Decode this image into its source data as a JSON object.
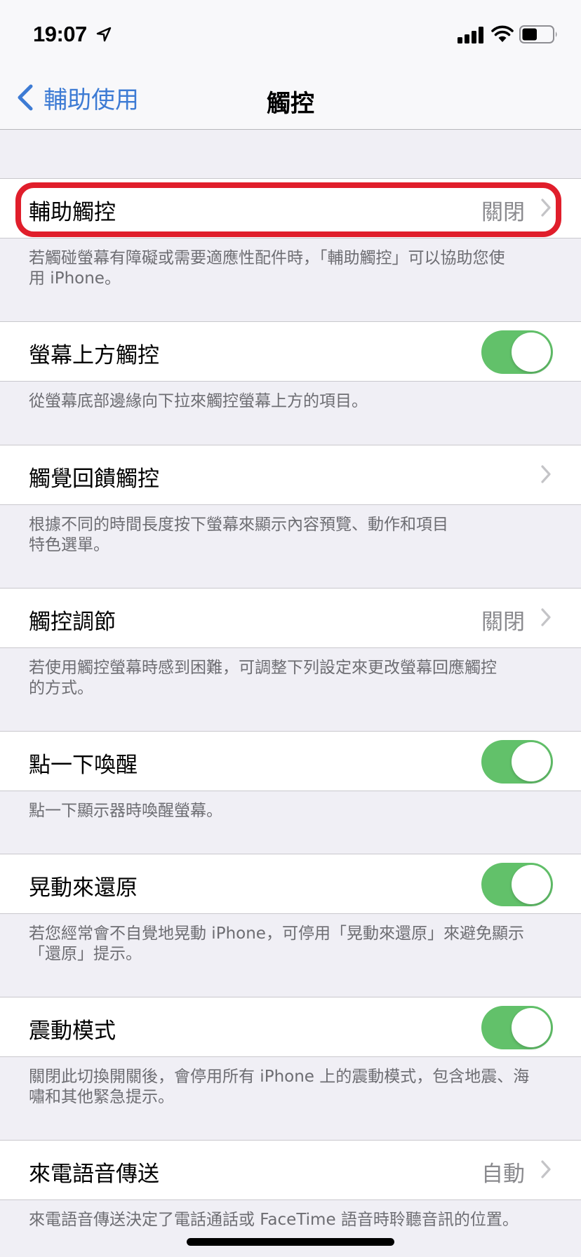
{
  "status_bar": {
    "time": "19:07",
    "location_icon": "location-arrow-icon",
    "signal_icon": "cellular-signal-icon",
    "wifi_icon": "wifi-icon",
    "battery_icon": "battery-icon",
    "battery_level": 0.5
  },
  "nav": {
    "back_label": "輔助使用",
    "back_icon": "chevron-left-icon",
    "title": "觸控"
  },
  "colors": {
    "accent": "#3d7bd4",
    "toggle_on": "#62c16a",
    "highlight": "#e01e2b",
    "background": "#f0eff5"
  },
  "settings": [
    {
      "label": "輔助觸控",
      "type": "disclosure",
      "value": "關閉",
      "highlighted": true,
      "footer_lines": [
        "若觸碰螢幕有障礙或需要適應性配件時，「輔助觸控」可以協助您使",
        "用 iPhone。"
      ]
    },
    {
      "label": "螢幕上方觸控",
      "type": "toggle",
      "on": true,
      "footer_lines": [
        "從螢幕底部邊緣向下拉來觸控螢幕上方的項目。"
      ]
    },
    {
      "label": "觸覺回饋觸控",
      "type": "disclosure",
      "value": "",
      "footer_lines": [
        "根據不同的時間長度按下螢幕來顯示內容預覽、動作和項目",
        "特色選單。"
      ]
    },
    {
      "label": "觸控調節",
      "type": "disclosure",
      "value": "關閉",
      "footer_lines": [
        "若使用觸控螢幕時感到困難，可調整下列設定來更改螢幕回應觸控",
        "的方式。"
      ]
    },
    {
      "label": "點一下喚醒",
      "type": "toggle",
      "on": true,
      "footer_lines": [
        "點一下顯示器時喚醒螢幕。"
      ]
    },
    {
      "label": "晃動來還原",
      "type": "toggle",
      "on": true,
      "footer_lines": [
        "若您經常會不自覺地晃動 iPhone，可停用「晃動來還原」來避免顯示",
        "「還原」提示。"
      ]
    },
    {
      "label": "震動模式",
      "type": "toggle",
      "on": true,
      "footer_lines": [
        "關閉此切換開關後，會停用所有 iPhone 上的震動模式，包含地震、海",
        "嘯和其他緊急提示。"
      ]
    },
    {
      "label": "來電語音傳送",
      "type": "disclosure",
      "value": "自動",
      "footer_lines": [
        "來電語音傳送決定了電話通話或 FaceTime 語音時聆聽音訊的位置。"
      ]
    }
  ]
}
